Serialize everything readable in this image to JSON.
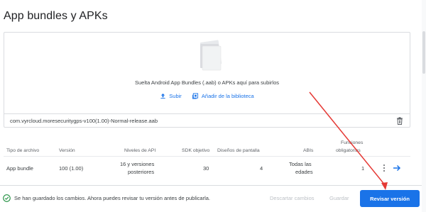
{
  "page": {
    "title": "App bundles y APKs"
  },
  "upload": {
    "drop_text": "Suelta Android App Bundles (.aab) o APKs aquí para subirlos",
    "upload_label": "Subir",
    "library_label": "Añadir de la biblioteca",
    "file_name": "com.vyrcloud.moresecuritygps-v100(1.00)-Normal-release.aab"
  },
  "table": {
    "headers": {
      "tipo": "Tipo de archivo",
      "version": "Versión",
      "niveles_api": "Niveles de API",
      "sdk": "SDK objetivo",
      "disenos": "Diseños de pantalla",
      "abis": "ABIs",
      "funciones_1": "Funciones",
      "funciones_2": "obligatorias"
    },
    "rows": [
      {
        "tipo": "App bundle",
        "version": "100 (1.00)",
        "api_1": "16 y versiones",
        "api_2": "posteriores",
        "sdk": "30",
        "disenos": "4",
        "abis_1": "Todas las",
        "abis_2": "edades",
        "funciones": "1"
      }
    ]
  },
  "snackbar": {
    "message": "Se han guardado los cambios. Ahora puedes revisar tu versión antes de publicarla.",
    "discard": "Descartar cambios",
    "save": "Guardar",
    "review": "Revisar versión"
  },
  "colors": {
    "accent": "#1a73e8",
    "success": "#1e8e3e",
    "annotation": "#e53935"
  }
}
